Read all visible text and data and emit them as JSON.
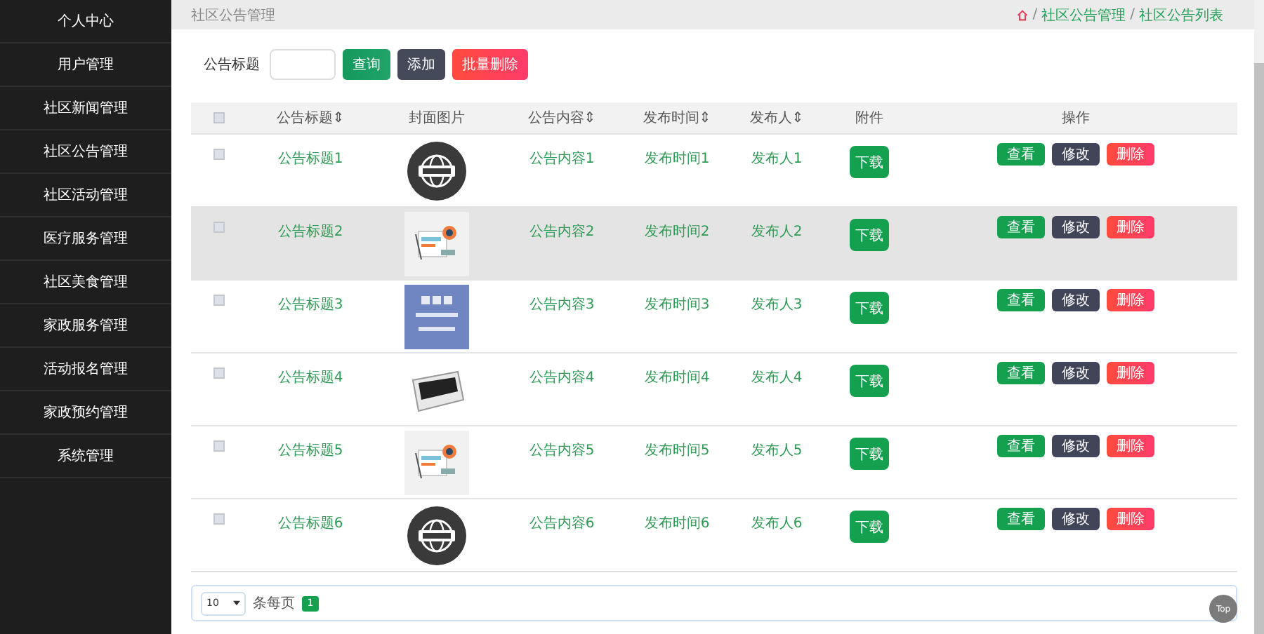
{
  "sidebar": {
    "items": [
      {
        "label": "个人中心",
        "selected": false
      },
      {
        "label": "用户管理",
        "selected": false
      },
      {
        "label": "社区新闻管理",
        "selected": false
      },
      {
        "label": "社区公告管理",
        "selected": false
      },
      {
        "label": "社区活动管理",
        "selected": false
      },
      {
        "label": "医疗服务管理",
        "selected": false
      },
      {
        "label": "社区美食管理",
        "selected": false
      },
      {
        "label": "家政服务管理",
        "selected": false
      },
      {
        "label": "活动报名管理",
        "selected": false
      },
      {
        "label": "家政预约管理",
        "selected": false
      },
      {
        "label": "系统管理",
        "selected": false
      }
    ]
  },
  "header": {
    "title": "社区公告管理",
    "separator": "/",
    "breadcrumb": [
      "社区公告管理",
      "社区公告列表"
    ]
  },
  "search": {
    "label": "公告标题",
    "buttons": [
      {
        "label": "查询",
        "kind": "search"
      },
      {
        "label": "添加",
        "kind": "add"
      },
      {
        "label": "批量删除",
        "kind": "delete"
      }
    ]
  },
  "table": {
    "all_checked": false,
    "columns": [
      "公告标题⇕",
      "封面图片",
      "公告内容⇕",
      "发布时间⇕",
      "发布人⇕",
      "附件",
      "操作"
    ],
    "rows": [
      {
        "title": "公告标题1",
        "content": "公告内容1",
        "time": "发布时间1",
        "publisher": "发布人1",
        "checked": false,
        "highlighted": false,
        "download": "下载",
        "actions": [
          {
            "label": "查看",
            "kind": "view"
          },
          {
            "label": "修改",
            "kind": "edit"
          },
          {
            "label": "删除",
            "kind": "delete"
          }
        ]
      },
      {
        "title": "公告标题2",
        "content": "公告内容2",
        "time": "发布时间2",
        "publisher": "发布人2",
        "checked": false,
        "highlighted": true,
        "download": "下载",
        "actions": [
          {
            "label": "查看",
            "kind": "view"
          },
          {
            "label": "修改",
            "kind": "edit"
          },
          {
            "label": "删除",
            "kind": "delete"
          }
        ]
      },
      {
        "title": "公告标题3",
        "content": "公告内容3",
        "time": "发布时间3",
        "publisher": "发布人3",
        "checked": false,
        "highlighted": false,
        "download": "下载",
        "actions": [
          {
            "label": "查看",
            "kind": "view"
          },
          {
            "label": "修改",
            "kind": "edit"
          },
          {
            "label": "删除",
            "kind": "delete"
          }
        ]
      },
      {
        "title": "公告标题4",
        "content": "公告内容4",
        "time": "发布时间4",
        "publisher": "发布人4",
        "checked": false,
        "highlighted": false,
        "download": "下载",
        "actions": [
          {
            "label": "查看",
            "kind": "view"
          },
          {
            "label": "修改",
            "kind": "edit"
          },
          {
            "label": "删除",
            "kind": "delete"
          }
        ]
      },
      {
        "title": "公告标题5",
        "content": "公告内容5",
        "time": "发布时间5",
        "publisher": "发布人5",
        "checked": false,
        "highlighted": false,
        "download": "下载",
        "actions": [
          {
            "label": "查看",
            "kind": "view"
          },
          {
            "label": "修改",
            "kind": "edit"
          },
          {
            "label": "删除",
            "kind": "delete"
          }
        ]
      },
      {
        "title": "公告标题6",
        "content": "公告内容6",
        "time": "发布时间6",
        "publisher": "发布人6",
        "checked": false,
        "highlighted": false,
        "download": "下载",
        "actions": [
          {
            "label": "查看",
            "kind": "view"
          },
          {
            "label": "修改",
            "kind": "edit"
          },
          {
            "label": "删除",
            "kind": "delete"
          }
        ]
      }
    ]
  },
  "pagination": {
    "page_size": "10",
    "per_page_label": "条每页",
    "pages": [
      {
        "label": "1",
        "selected": true
      }
    ]
  },
  "top_button": "Top"
}
